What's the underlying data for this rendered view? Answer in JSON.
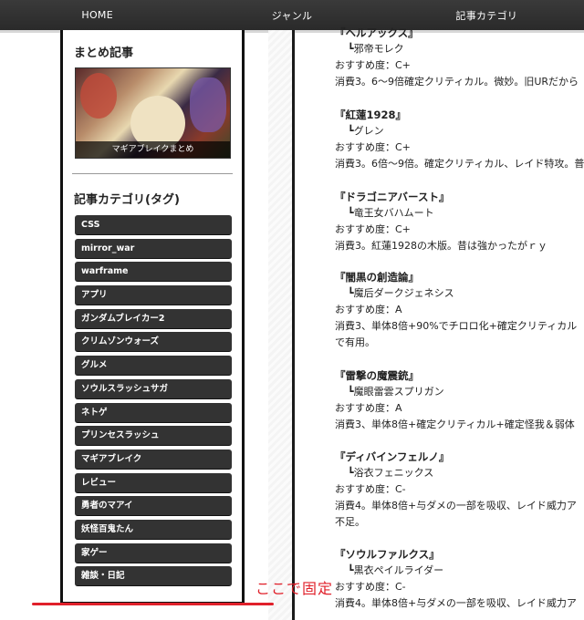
{
  "nav": {
    "items": [
      "HOME",
      "ジャンル",
      "記事カテゴリ"
    ]
  },
  "sidebar": {
    "matome_heading": "まとめ記事",
    "matome_caption": "マギアブレイクまとめ",
    "category_heading": "記事カテゴリ(タグ)",
    "tags": [
      "CSS",
      "mirror_war",
      "warframe",
      "アプリ",
      "ガンダムブレイカー2",
      "クリムゾンウォーズ",
      "グルメ",
      "ソウルスラッシュサガ",
      "ネトゲ",
      "プリンセスラッシュ",
      "マギアブレイク",
      "レビュー",
      "勇者のマアイ",
      "妖怪百鬼たん",
      "家ゲー",
      "雑談・日記"
    ]
  },
  "annotation": {
    "text": "ここで固定",
    "color": "#e0202a"
  },
  "main": {
    "entries": [
      {
        "title": "『ヘルアックス』",
        "char": "┗邪帝モレク",
        "rating": "おすすめ度：C+",
        "desc": [
          "消費3。6～9倍確定クリティカル。微妙。旧URだから"
        ]
      },
      {
        "title": "『紅蓮1928』",
        "char": "┗グレン",
        "rating": "おすすめ度：C+",
        "desc": [
          "消費3。6倍～9倍。確定クリティカル、レイド特攻。普"
        ]
      },
      {
        "title": "『ドラゴニアバースト』",
        "char": "┗竜王女バハムート",
        "rating": "おすすめ度：C+",
        "desc": [
          "消費3。紅蓮1928の木版。昔は強かったがｒｙ"
        ]
      },
      {
        "title": "『闇黒の創造論』",
        "char": "┗魔后ダークジェネシス",
        "rating": "おすすめ度：A",
        "desc": [
          "消費3、単体8倍+90%でチロロ化+確定クリティカル",
          "で有用。"
        ]
      },
      {
        "title": "『雷撃の魔震銃』",
        "char": "┗魔眼雷雲スプリガン",
        "rating": "おすすめ度：A",
        "desc": [
          "消費3、単体8倍+確定クリティカル+確定怪我＆弱体"
        ]
      },
      {
        "title": "『ディバインフェルノ』",
        "char": "┗浴衣フェニックス",
        "rating": "おすすめ度：C-",
        "desc": [
          "消費4。単体8倍+与ダメの一部を吸収、レイド威力ア",
          "不足。"
        ]
      },
      {
        "title": "『ソウルファルクス』",
        "char": "┗黒衣ペイルライダー",
        "rating": "おすすめ度：C-",
        "desc": [
          "消費4。単体8倍+与ダメの一部を吸収、レイド威力ア"
        ]
      }
    ]
  }
}
